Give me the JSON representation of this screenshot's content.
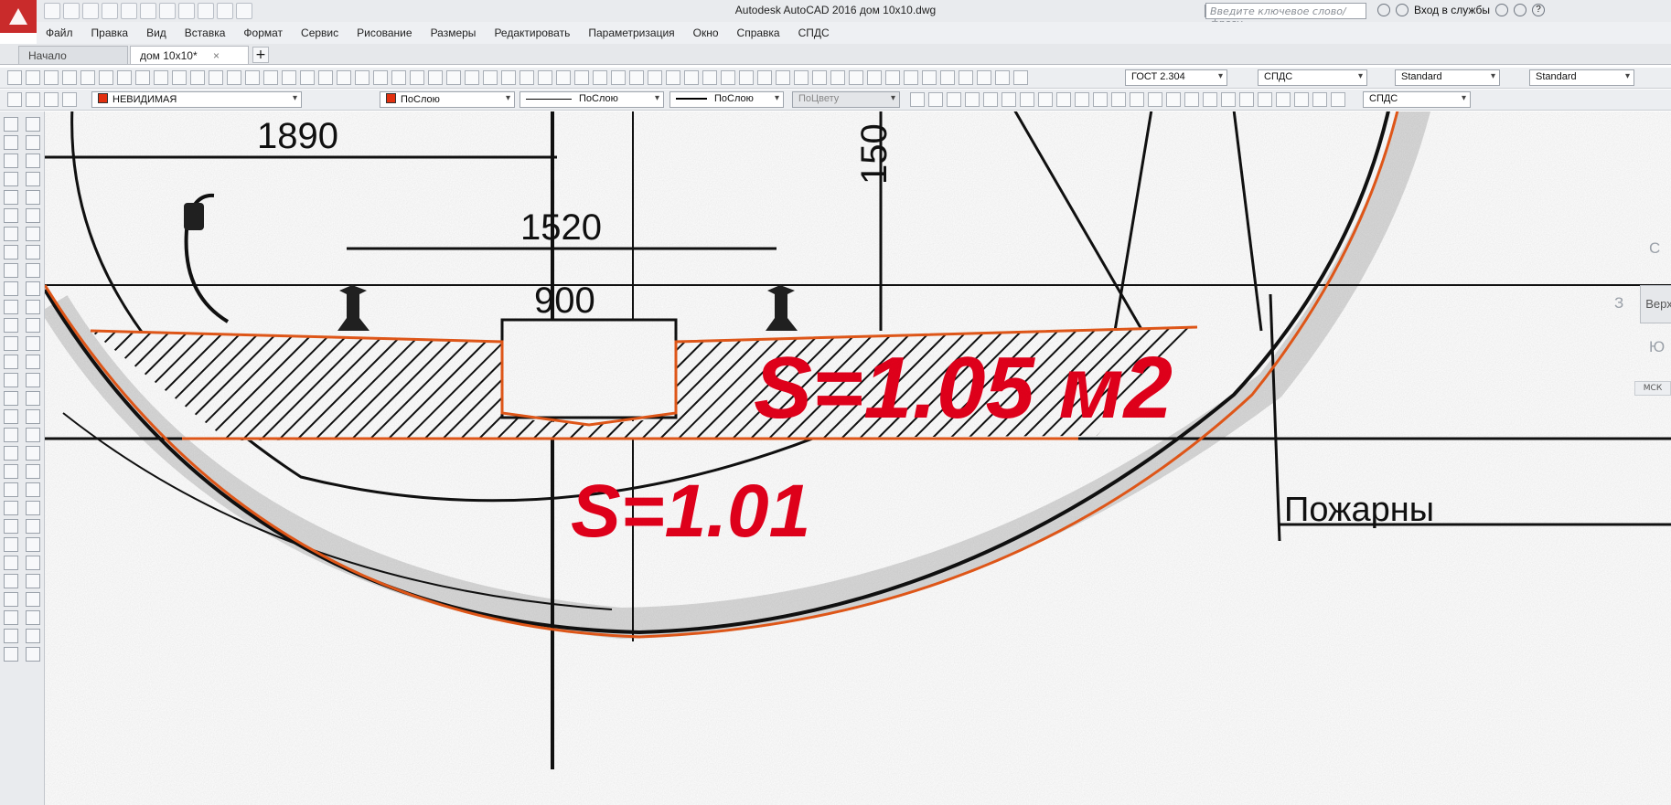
{
  "window": {
    "title": "Autodesk AutoCAD 2016   дом 10x10.dwg",
    "search_placeholder": "Введите ключевое слово/фразу",
    "account_label": "Вход в службы",
    "help_label": "?"
  },
  "menu": [
    "Файл",
    "Правка",
    "Вид",
    "Вставка",
    "Формат",
    "Сервис",
    "Рисование",
    "Размеры",
    "Редактировать",
    "Параметризация",
    "Окно",
    "Справка",
    "СПДС"
  ],
  "tabs": {
    "start": "Начало",
    "doc": "дом 10x10*",
    "doc_close": "×",
    "add": "+"
  },
  "toolbar1": {
    "text_style": "ГОСТ 2.304",
    "dim_style": "СПДС",
    "table_style": "Standard",
    "mleader_style": "Standard"
  },
  "toolbar2": {
    "layer": "НЕВИДИМАЯ",
    "color": "ПоСлою",
    "linetype": "ПоСлою",
    "lineweight": "ПоСлою",
    "plotstyle": "ПоЦвету",
    "spds_combo": "СПДС"
  },
  "drawing": {
    "dim_1890": "1890",
    "dim_1520": "1520",
    "dim_900": "900",
    "dim_150": "150",
    "area_large": "S=1.05 м2",
    "area_small": "S=1.01",
    "label_fire": "Пожарны",
    "accent_color": "#e8001c",
    "outline_color": "#e85a1a"
  },
  "viewcube": {
    "north": "С",
    "west": "З",
    "south": "Ю",
    "top": "Верх",
    "ucs": "МСК"
  }
}
